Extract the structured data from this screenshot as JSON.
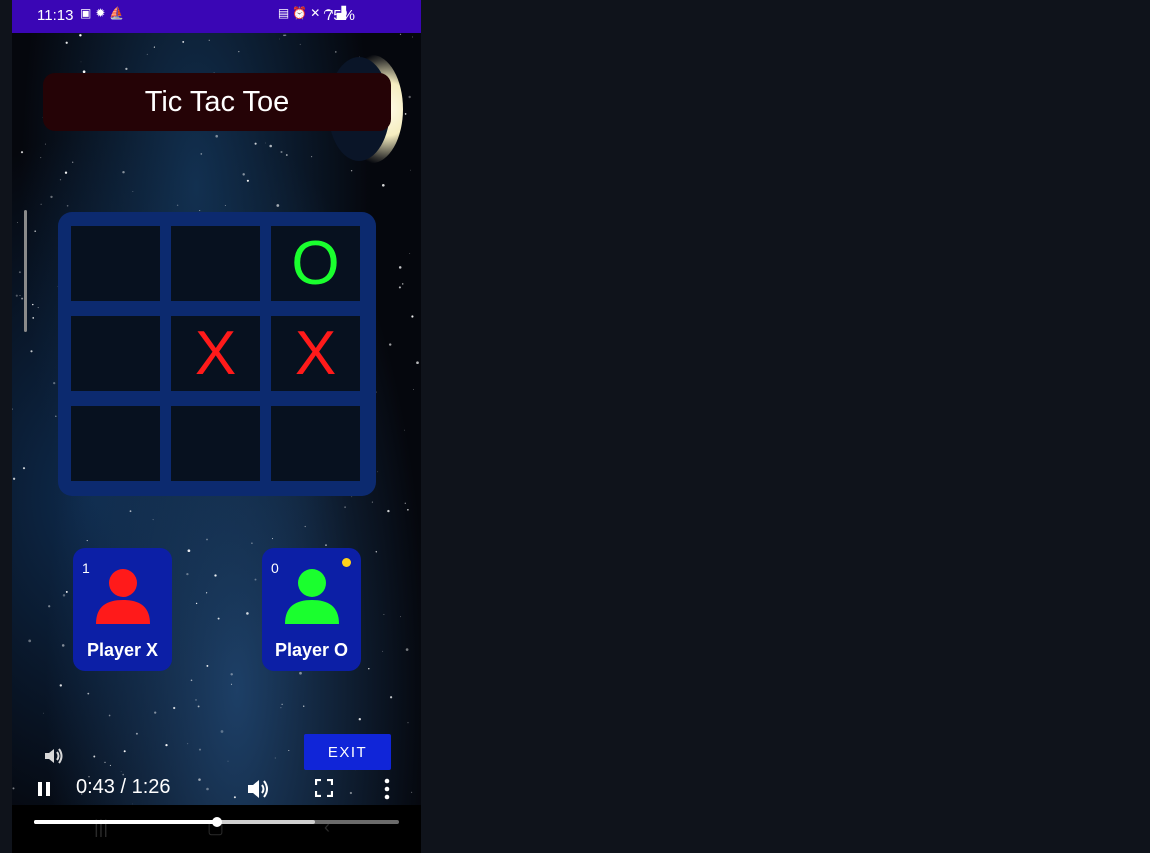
{
  "status_bar": {
    "time": "11:13",
    "left_icons": [
      "screenshot-icon",
      "brightness-icon",
      "cast-icon"
    ],
    "right_icons": [
      "lock-icon",
      "alarm-icon",
      "mute-icon",
      "wifi-icon",
      "signal-icon"
    ],
    "battery": "75%"
  },
  "game": {
    "title": "Tic Tac Toe",
    "board": [
      "",
      "",
      "O",
      "",
      "X",
      "X",
      "",
      "",
      ""
    ],
    "colors": {
      "x": "#ff1a1a",
      "o": "#1aff2e",
      "board_frame": "#0c2a6f",
      "title_bg": "#250306"
    }
  },
  "players": [
    {
      "name": "Player X",
      "score": "1",
      "color": "#ff1a1a",
      "active": false
    },
    {
      "name": "Player O",
      "score": "0",
      "color": "#1aff2e",
      "active": true
    }
  ],
  "exit_label": "EXIT",
  "video": {
    "time_label": "0:43 / 1:26",
    "progress": 0.5,
    "buffered": 0.77,
    "icons": [
      "pause-icon",
      "volume-icon",
      "fullscreen-icon",
      "more-icon"
    ]
  }
}
